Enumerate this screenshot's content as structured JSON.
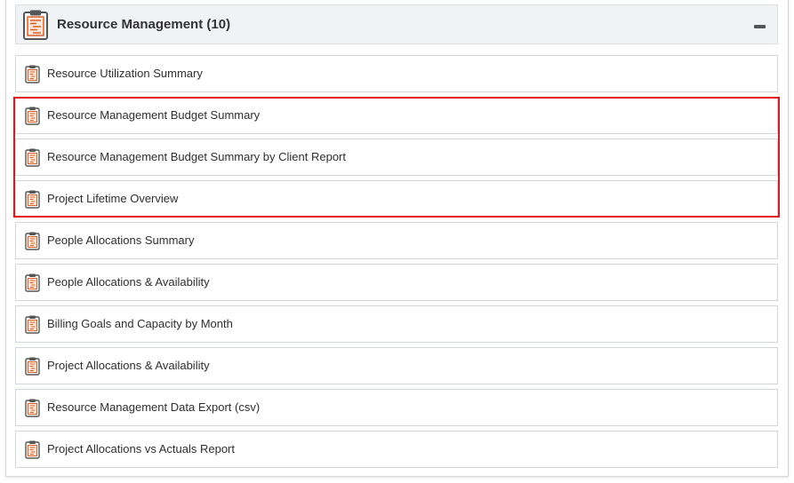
{
  "section": {
    "title": "Resource Management (10)",
    "header_icon": "clipboard-report-icon",
    "collapse_icon": "minus-icon"
  },
  "reports": [
    {
      "label": "Resource Utilization Summary",
      "icon": "clipboard-report-icon"
    },
    {
      "label": "Resource Management Budget Summary",
      "icon": "clipboard-report-icon"
    },
    {
      "label": "Resource Management Budget Summary by Client Report",
      "icon": "clipboard-report-icon"
    },
    {
      "label": "Project Lifetime Overview",
      "icon": "clipboard-report-icon"
    },
    {
      "label": "People Allocations Summary",
      "icon": "clipboard-report-icon"
    },
    {
      "label": "People Allocations & Availability",
      "icon": "clipboard-report-icon"
    },
    {
      "label": "Billing Goals and Capacity by Month",
      "icon": "clipboard-report-icon"
    },
    {
      "label": "Project Allocations & Availability",
      "icon": "clipboard-report-icon"
    },
    {
      "label": "Resource Management Data Export (csv)",
      "icon": "clipboard-report-icon"
    },
    {
      "label": "Project Allocations vs Actuals Report",
      "icon": "clipboard-report-icon"
    }
  ],
  "colors": {
    "icon_orange": "#d9622b",
    "icon_clip": "#555555",
    "highlight_red": "#e3141b",
    "header_bg": "#f1f2f4"
  }
}
